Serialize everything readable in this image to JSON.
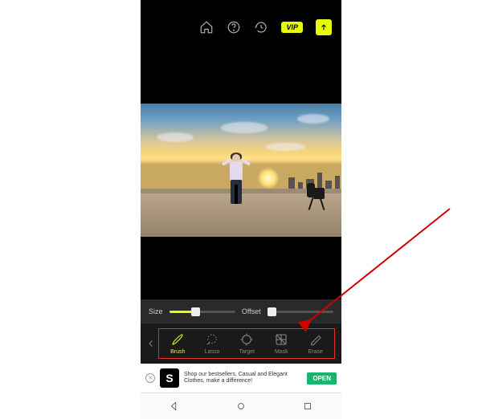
{
  "topbar": {
    "vip_label": "VIP"
  },
  "sliders": {
    "size_label": "Size",
    "offset_label": "Offset"
  },
  "tools": [
    {
      "label": "Brush",
      "active": true
    },
    {
      "label": "Lasso",
      "active": false
    },
    {
      "label": "Target",
      "active": false
    },
    {
      "label": "Mask",
      "active": false
    },
    {
      "label": "Erase",
      "active": false
    }
  ],
  "ad": {
    "logo_letter": "S",
    "text": "Shop our bestsellers, Casual and Elegant Clothes, make a difference!",
    "cta": "OPEN"
  }
}
